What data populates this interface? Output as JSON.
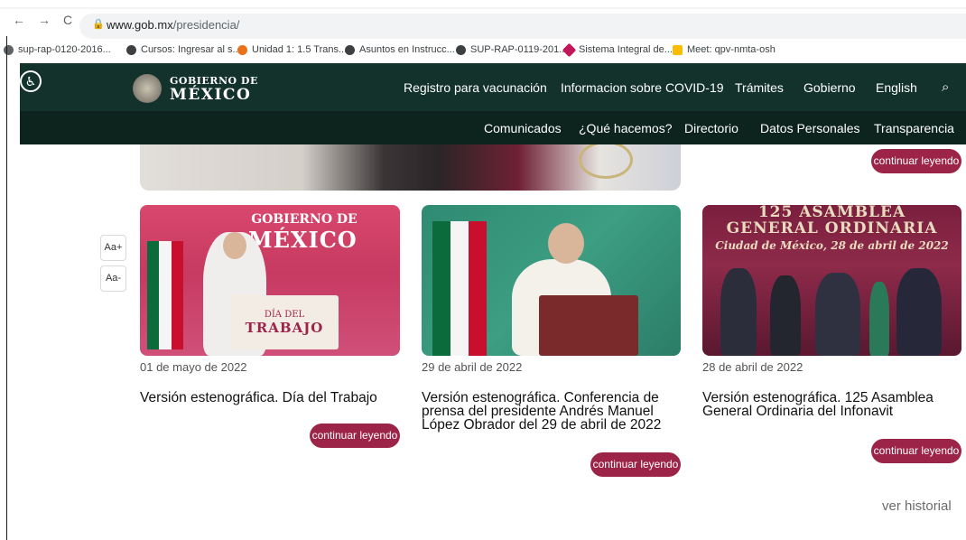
{
  "browser": {
    "url_domain": "www.gob.mx",
    "url_path": "/presidencia/",
    "bookmarks": [
      {
        "label": "sup-rap-0120-2016...",
        "color": "#5f6368"
      },
      {
        "label": "Cursos: Ingresar al s...",
        "color": "#3c4043"
      },
      {
        "label": "Unidad 1: 1.5 Trans...",
        "color": "#e8711a"
      },
      {
        "label": "Asuntos en Instrucc...",
        "color": "#3c4043"
      },
      {
        "label": "SUP-RAP-0119-201...",
        "color": "#3c4043"
      },
      {
        "label": "Sistema Integral de...",
        "color": "#c2185b"
      },
      {
        "label": "Meet: qpv-nmta-osh",
        "color": "#fbbc04"
      }
    ]
  },
  "header": {
    "logo_line1": "GOBIERNO DE",
    "logo_line2": "MÉXICO",
    "top_nav": [
      "Registro para vacunación",
      "Informacion sobre COVID-19",
      "Trámites",
      "Gobierno",
      "English"
    ],
    "sub_nav": [
      "Comunicados",
      "¿Qué hacemos?",
      "Directorio",
      "Datos Personales",
      "Transparencia"
    ],
    "colors": {
      "top": "#13322b",
      "sub": "#0c231e",
      "accent": "#9d2449"
    }
  },
  "accessibility": {
    "increase": "Aa+",
    "decrease": "Aa-"
  },
  "top_button": "continuar leyendo",
  "cards": [
    {
      "date": "01 de mayo de 2022",
      "title": "Versión estenográfica. Día del Trabajo",
      "button": "continuar leyendo",
      "image_text": {
        "banner_small": "GOBIERNO DE",
        "banner_big": "MÉXICO",
        "podium_small": "DÍA DEL",
        "podium_big": "TRABAJO"
      }
    },
    {
      "date": "29 de abril de 2022",
      "title": "Versión estenográfica. Conferencia de prensa del presidente Andrés Manuel López Obrador del 29 de abril de 2022",
      "button": "continuar leyendo"
    },
    {
      "date": "28 de abril de 2022",
      "title": "Versión estenográfica. 125 Asamblea General Ordinaria del Infonavit",
      "button": "continuar leyendo",
      "image_text": {
        "line1": "125 ASAMBLEA",
        "line2": "GENERAL ORDINARIA",
        "line3": "Ciudad de México, 28 de abril de 2022"
      }
    }
  ],
  "history_link": "ver historial"
}
